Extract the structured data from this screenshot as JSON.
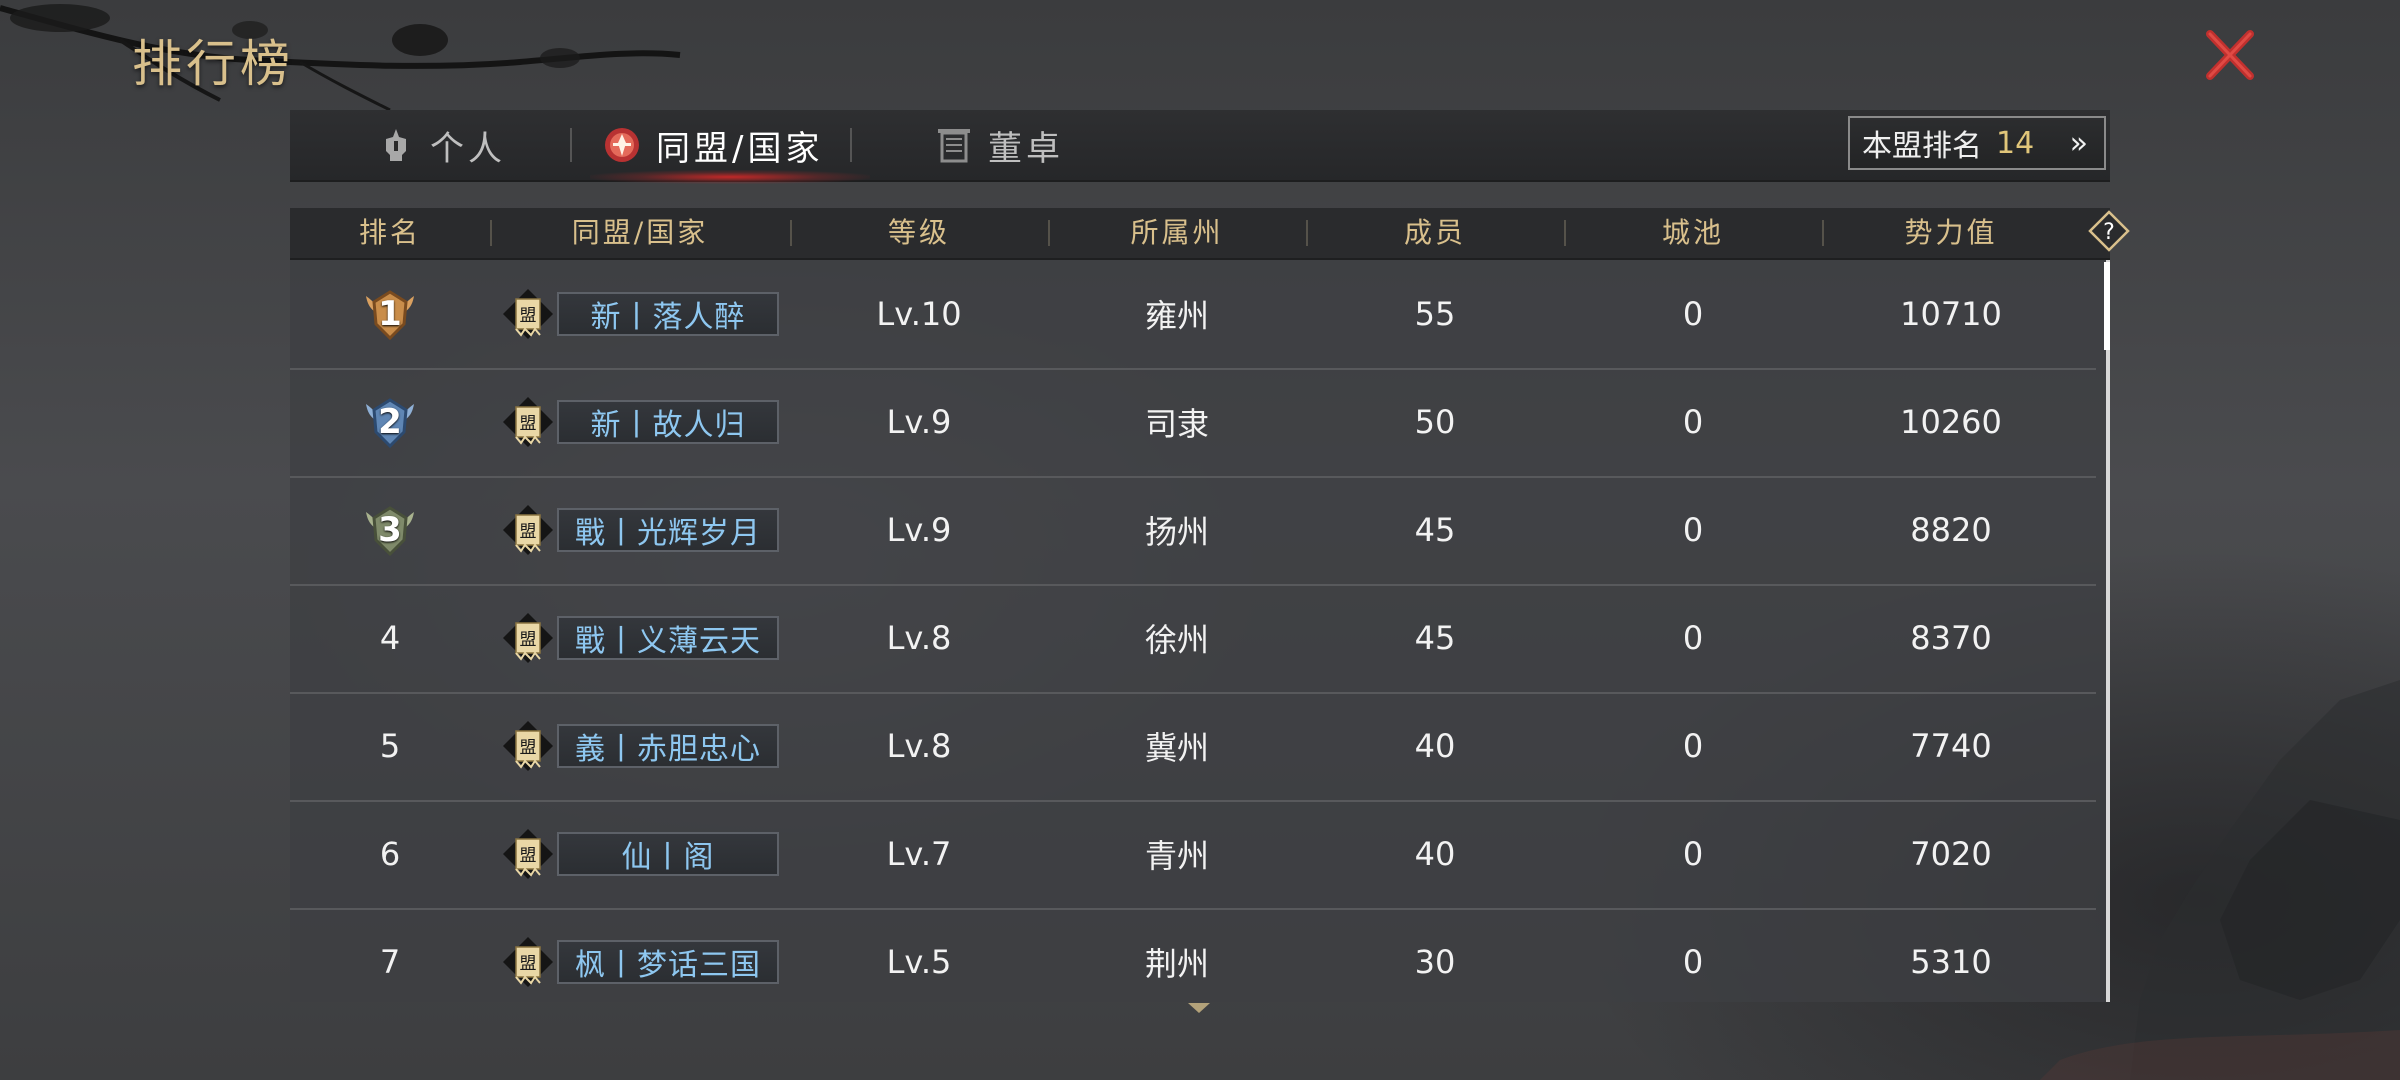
{
  "page": {
    "title": "排行榜"
  },
  "tabs": [
    {
      "label": "个人",
      "icon": "helmet-icon",
      "active": false
    },
    {
      "label": "同盟/国家",
      "icon": "alliance-emblem-icon",
      "active": true
    },
    {
      "label": "董卓",
      "icon": "banner-icon",
      "active": false
    }
  ],
  "my_rank": {
    "label": "本盟排名",
    "value": "14",
    "arrow_icon": "double-chevron-right-icon"
  },
  "columns": [
    "排名",
    "同盟/国家",
    "等级",
    "所属州",
    "成员",
    "城池",
    "势力值"
  ],
  "rows": [
    {
      "rank": "1",
      "medal": "gold",
      "name": "新丨落人醉",
      "level": "Lv.10",
      "state": "雍州",
      "members": "55",
      "cities": "0",
      "power": "10710"
    },
    {
      "rank": "2",
      "medal": "silver",
      "name": "新丨故人归",
      "level": "Lv.9",
      "state": "司隶",
      "members": "50",
      "cities": "0",
      "power": "10260"
    },
    {
      "rank": "3",
      "medal": "bronze",
      "name": "戰丨光辉岁月",
      "level": "Lv.9",
      "state": "扬州",
      "members": "45",
      "cities": "0",
      "power": "8820"
    },
    {
      "rank": "4",
      "medal": "",
      "name": "戰丨义薄云天",
      "level": "Lv.8",
      "state": "徐州",
      "members": "45",
      "cities": "0",
      "power": "8370"
    },
    {
      "rank": "5",
      "medal": "",
      "name": "義丨赤胆忠心",
      "level": "Lv.8",
      "state": "冀州",
      "members": "40",
      "cities": "0",
      "power": "7740"
    },
    {
      "rank": "6",
      "medal": "",
      "name": "仙丨阁",
      "level": "Lv.7",
      "state": "青州",
      "members": "40",
      "cities": "0",
      "power": "7020"
    },
    {
      "rank": "7",
      "medal": "",
      "name": "枫丨梦话三国",
      "level": "Lv.5",
      "state": "荆州",
      "members": "30",
      "cities": "0",
      "power": "5310"
    }
  ],
  "badge_char": "盟",
  "colors": {
    "gold_text": "#d9c08c",
    "alliance_name": "#8ec7f0",
    "close_red": "#c0302e",
    "tab_highlight": "#d22828"
  }
}
